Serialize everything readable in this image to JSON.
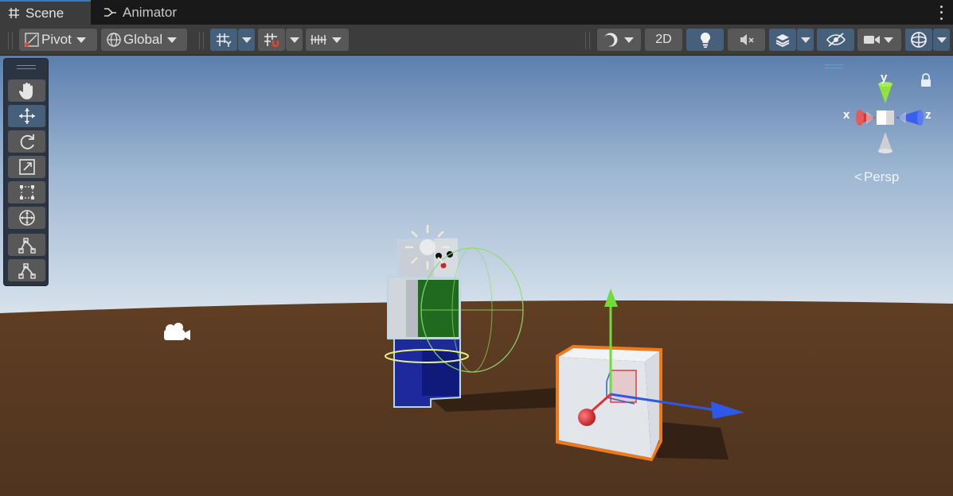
{
  "tabs": [
    {
      "label": "Scene",
      "active": true,
      "icon": "grid-hash-icon"
    },
    {
      "label": "Animator",
      "active": false,
      "icon": "animator-graph-icon"
    }
  ],
  "toolbar": {
    "pivot_label": "Pivot",
    "global_label": "Global",
    "toggle_2d_label": "2D"
  },
  "tools": [
    {
      "name": "hand-tool",
      "icon": "hand-icon",
      "selected": false
    },
    {
      "name": "move-tool",
      "icon": "move-arrows-icon",
      "selected": true
    },
    {
      "name": "rotate-tool",
      "icon": "rotate-icon",
      "selected": false
    },
    {
      "name": "scale-tool",
      "icon": "scale-icon",
      "selected": false
    },
    {
      "name": "rect-tool",
      "icon": "rect-transform-icon",
      "selected": false
    },
    {
      "name": "transform-tool",
      "icon": "transform-icon",
      "selected": false
    },
    {
      "name": "custom-tool-1",
      "icon": "bone-tool-icon",
      "selected": false
    },
    {
      "name": "custom-tool-2",
      "icon": "bone-tool-icon",
      "selected": false
    }
  ],
  "gizmo": {
    "x_label": "x",
    "y_label": "y",
    "z_label": "z",
    "projection_label": "Persp"
  },
  "colors": {
    "accent_blue": "#46607c",
    "tab_highlight": "#3a79bb",
    "x_axis": "#e03030",
    "y_axis": "#6fdc3a",
    "z_axis": "#2f58e8",
    "selection_outline": "#f07a1a",
    "ground": "#5a3a22"
  }
}
